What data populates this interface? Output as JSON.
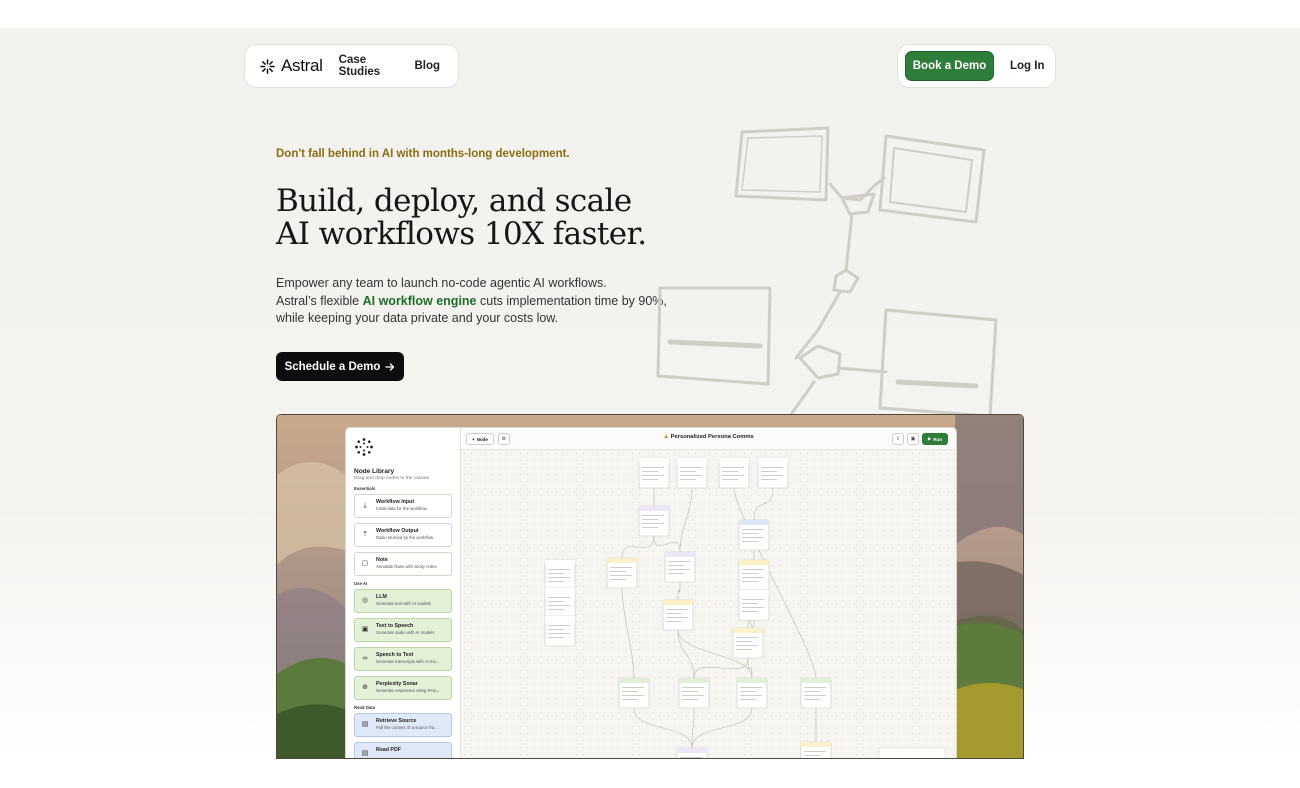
{
  "nav": {
    "brand": "Astral",
    "links": [
      "Case Studies",
      "Blog"
    ],
    "book_demo": "Book a Demo",
    "login": "Log In"
  },
  "hero": {
    "eyebrow": "Don't fall behind in AI with months-long development.",
    "headline_lines": [
      "Build, deploy, and scale",
      "AI workflows 10X faster."
    ],
    "sub_line1": "Empower any team to launch no-code agentic AI workflows.",
    "sub_line2_pre": "Astral’s flexible ",
    "sub_line2_highlight": "AI workflow engine",
    "sub_line2_post": " cuts implementation time by 90%,",
    "sub_line3": "while keeping your data private and your costs low.",
    "cta": "Schedule a Demo"
  },
  "colors": {
    "brand_green": "#2f7d3a",
    "eyebrow_gold": "#8a6d12",
    "highlight_green": "#1f6b2a"
  },
  "app": {
    "library": {
      "title": "Node Library",
      "subtitle": "Drag and drop nodes to the canvas",
      "sections": [
        {
          "name": "Essentials",
          "items": [
            {
              "name": "Workflow Input",
              "desc": "Initial data for the workflow",
              "icon": "download-icon",
              "glyph": "⤓",
              "tone": "plain"
            },
            {
              "name": "Workflow Output",
              "desc": "Data returned by the workflow",
              "icon": "upload-icon",
              "glyph": "⤒",
              "tone": "plain"
            },
            {
              "name": "Note",
              "desc": "Annotate flows with sticky notes",
              "icon": "note-icon",
              "glyph": "▢",
              "tone": "plain"
            }
          ]
        },
        {
          "name": "Use AI",
          "items": [
            {
              "name": "LLM",
              "desc": "Generate text with AI models",
              "icon": "brain-icon",
              "glyph": "◎",
              "tone": "green"
            },
            {
              "name": "Text to Speech",
              "desc": "Generate audio with AI models",
              "icon": "speech-bubble-icon",
              "glyph": "▣",
              "tone": "green"
            },
            {
              "name": "Speech to Text",
              "desc": "Generate transcripts with AI mo...",
              "icon": "voicemail-icon",
              "glyph": "∞",
              "tone": "green"
            },
            {
              "name": "Perplexity Sonar",
              "desc": "Generate responses using Perp...",
              "icon": "globe-icon",
              "glyph": "⊕",
              "tone": "green"
            }
          ]
        },
        {
          "name": "Read Data",
          "items": [
            {
              "name": "Retrieve Source",
              "desc": "Pull the content of a source fro...",
              "icon": "document-icon",
              "glyph": "▤",
              "tone": "blue"
            },
            {
              "name": "Read PDF",
              "desc": "",
              "icon": "pdf-icon",
              "glyph": "▤",
              "tone": "blue"
            }
          ]
        }
      ]
    },
    "toolbar": {
      "node_button": "Node",
      "workflow_title": "Personalized Persona Comms",
      "run_button": "Run"
    }
  }
}
